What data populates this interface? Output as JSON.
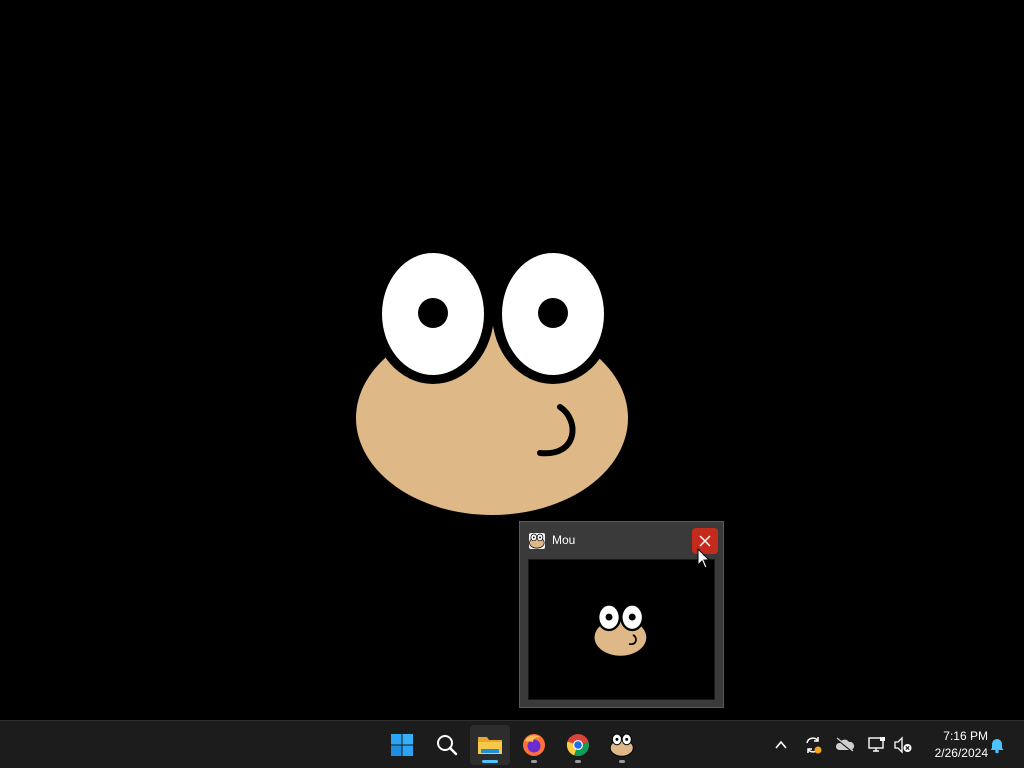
{
  "desktop": {
    "wallpaper_color": "#000000",
    "character_icon": "pou-face-icon"
  },
  "preview": {
    "app_name": "Mou",
    "close_icon": "close-icon",
    "close_color": "#c42b1c"
  },
  "taskbar": {
    "items": [
      {
        "name": "start-button",
        "icon": "windows-logo-icon"
      },
      {
        "name": "search-button",
        "icon": "search-icon"
      },
      {
        "name": "file-explorer-button",
        "icon": "folder-icon"
      },
      {
        "name": "firefox-button",
        "icon": "firefox-icon"
      },
      {
        "name": "chrome-button",
        "icon": "chrome-icon"
      },
      {
        "name": "mou-app-button",
        "icon": "pou-face-icon"
      }
    ],
    "tray": {
      "icons": [
        "chevron-up-icon",
        "sync-icon",
        "cloud-offline-icon",
        "network-icon",
        "volume-muted-icon",
        "notification-bell-icon"
      ],
      "time": "7:16 PM",
      "date": "2/26/2024"
    }
  }
}
